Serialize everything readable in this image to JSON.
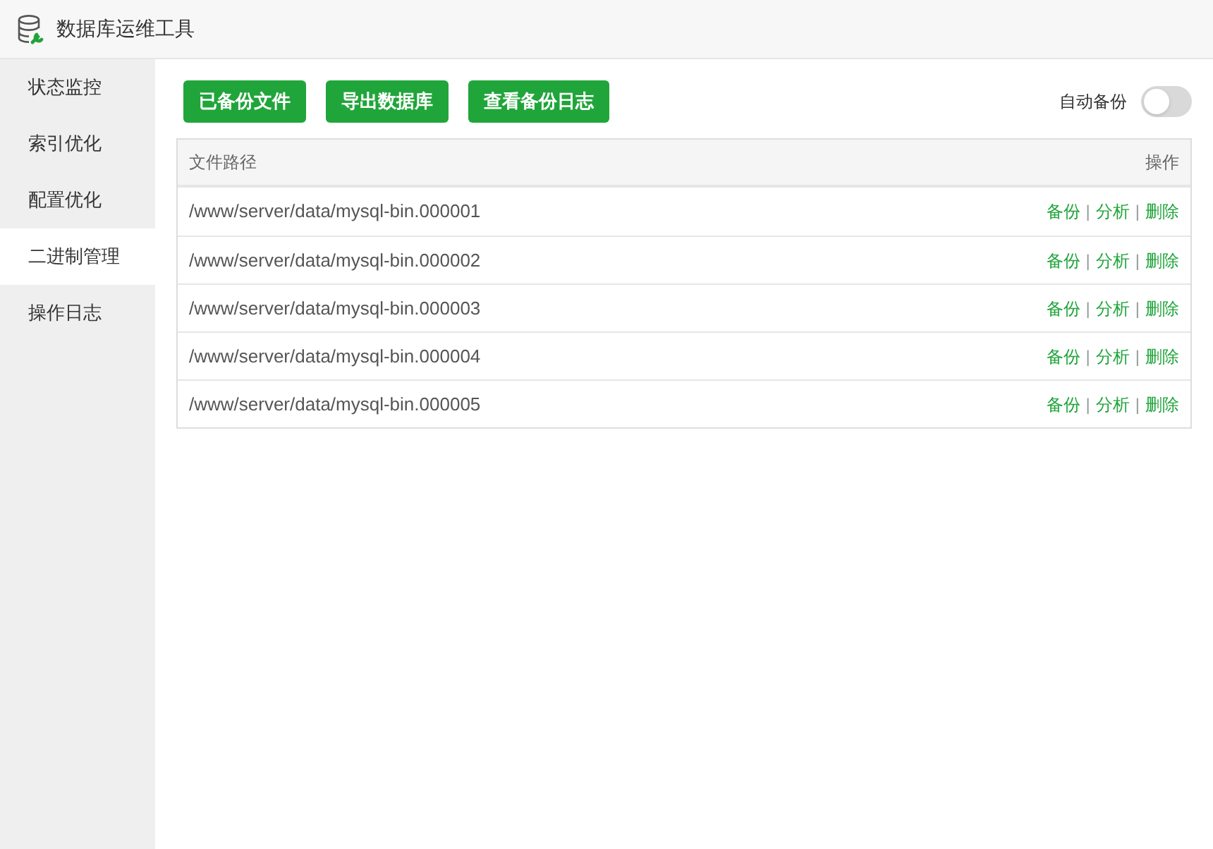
{
  "window": {
    "title": "数据库运维工具"
  },
  "sidebar": {
    "items": [
      {
        "label": "状态监控",
        "selected": false
      },
      {
        "label": "索引优化",
        "selected": false
      },
      {
        "label": "配置优化",
        "selected": false
      },
      {
        "label": "二进制管理",
        "selected": true
      },
      {
        "label": "操作日志",
        "selected": false
      }
    ]
  },
  "toolbar": {
    "buttons": [
      "已备份文件",
      "导出数据库",
      "查看备份日志"
    ],
    "auto_backup": {
      "label": "自动备份",
      "on": false
    }
  },
  "table": {
    "columns": [
      "文件路径",
      "操作"
    ],
    "rows": [
      {
        "path": "/www/server/data/mysql-bin.000001",
        "actions": [
          {
            "label": "备份",
            "separator": "|"
          },
          {
            "label": "分析",
            "separator": "|"
          },
          {
            "label": "删除"
          }
        ]
      },
      {
        "path": "/www/server/data/mysql-bin.000002",
        "actions": [
          {
            "label": "备份",
            "separator": "|"
          },
          {
            "label": "分析",
            "separator": "|"
          },
          {
            "label": "删除"
          }
        ]
      },
      {
        "path": "/www/server/data/mysql-bin.000003",
        "actions": [
          {
            "label": "备份",
            "separator": "|"
          },
          {
            "label": "分析",
            "separator": "|"
          },
          {
            "label": "删除"
          }
        ]
      },
      {
        "path": "/www/server/data/mysql-bin.000004",
        "actions": [
          {
            "label": "备份",
            "separator": "|"
          },
          {
            "label": "分析",
            "separator": "|"
          },
          {
            "label": "删除"
          }
        ]
      },
      {
        "path": "/www/server/data/mysql-bin.000005",
        "actions": [
          {
            "label": "备份",
            "separator": "|"
          },
          {
            "label": "分析",
            "separator": "|"
          },
          {
            "label": "删除"
          }
        ]
      }
    ]
  }
}
